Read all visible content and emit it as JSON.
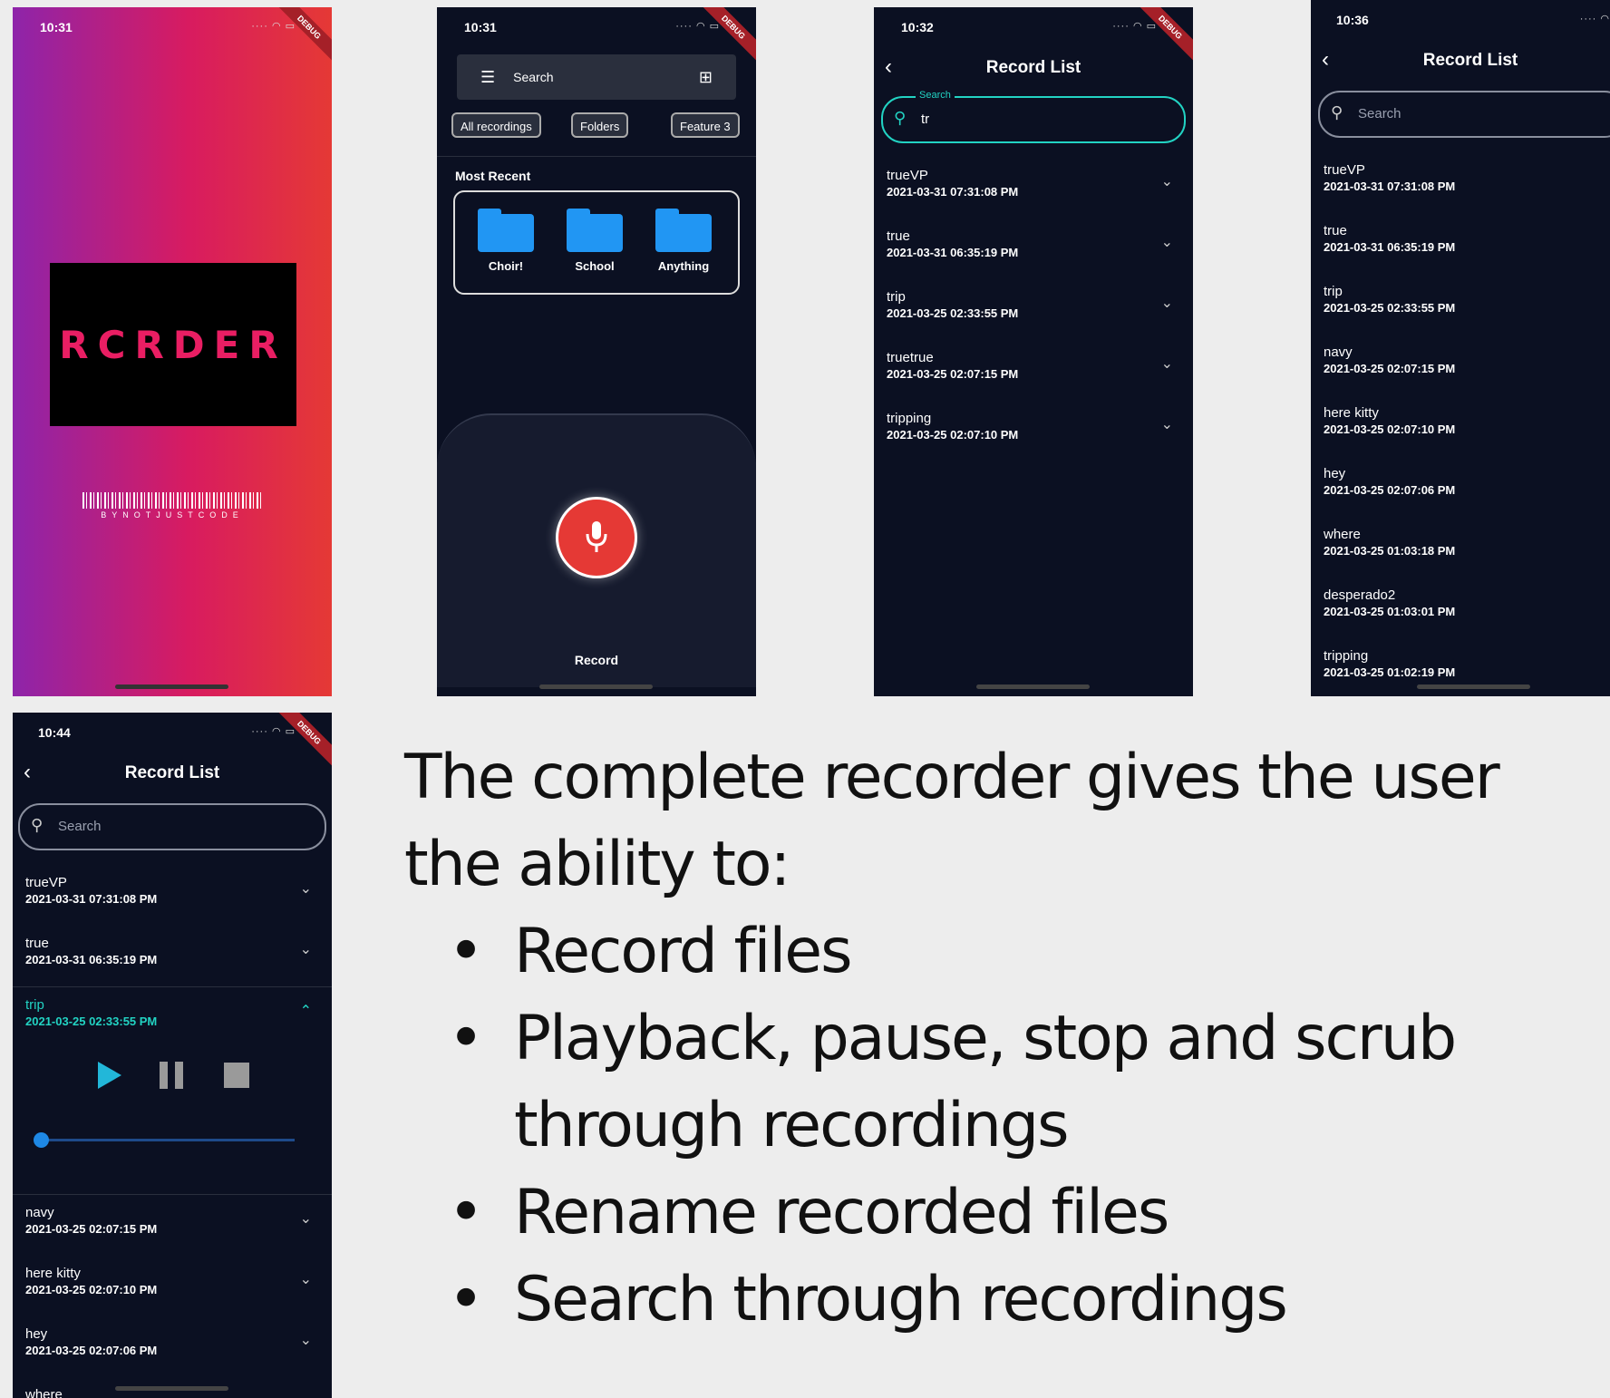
{
  "splash": {
    "time": "10:31",
    "logo": "RCRDER",
    "barcode_text": "BYNOTJUSTCODE",
    "debug": "DEBUG"
  },
  "home": {
    "time": "10:31",
    "search_label": "Search",
    "chips": [
      "All recordings",
      "Folders",
      "Feature 3"
    ],
    "most_recent_label": "Most Recent",
    "folders": [
      "Choir!",
      "School",
      "Anything"
    ],
    "record_label": "Record",
    "debug": "DEBUG"
  },
  "search_screen": {
    "time": "10:32",
    "title": "Record List",
    "search_float_label": "Search",
    "search_value": "tr",
    "items": [
      {
        "name": "trueVP",
        "date": "2021-03-31 07:31:08 PM"
      },
      {
        "name": "true",
        "date": "2021-03-31 06:35:19 PM"
      },
      {
        "name": "trip",
        "date": "2021-03-25 02:33:55 PM"
      },
      {
        "name": "truetrue",
        "date": "2021-03-25 02:07:15 PM"
      },
      {
        "name": "tripping",
        "date": "2021-03-25 02:07:10 PM"
      }
    ],
    "debug": "DEBUG"
  },
  "list_screen": {
    "time": "10:36",
    "title": "Record List",
    "search_placeholder": "Search",
    "items": [
      {
        "name": "trueVP",
        "date": "2021-03-31 07:31:08 PM"
      },
      {
        "name": "true",
        "date": "2021-03-31 06:35:19 PM"
      },
      {
        "name": "trip",
        "date": "2021-03-25 02:33:55 PM"
      },
      {
        "name": "navy",
        "date": "2021-03-25 02:07:15 PM"
      },
      {
        "name": "here kitty",
        "date": "2021-03-25 02:07:10 PM"
      },
      {
        "name": "hey",
        "date": "2021-03-25 02:07:06 PM"
      },
      {
        "name": "where",
        "date": "2021-03-25 01:03:18 PM"
      },
      {
        "name": "desperado2",
        "date": "2021-03-25 01:03:01 PM"
      },
      {
        "name": "tripping",
        "date": "2021-03-25 01:02:19 PM"
      }
    ]
  },
  "player_screen": {
    "time": "10:44",
    "title": "Record List",
    "search_placeholder": "Search",
    "items_before": [
      {
        "name": "trueVP",
        "date": "2021-03-31 07:31:08 PM"
      },
      {
        "name": "true",
        "date": "2021-03-31 06:35:19 PM"
      }
    ],
    "expanded": {
      "name": "trip",
      "date": "2021-03-25 02:33:55 PM"
    },
    "items_after": [
      {
        "name": "navy",
        "date": "2021-03-25 02:07:15 PM"
      },
      {
        "name": "here kitty",
        "date": "2021-03-25 02:07:10 PM"
      },
      {
        "name": "hey",
        "date": "2021-03-25 02:07:06 PM"
      },
      {
        "name": "where",
        "date": ""
      }
    ],
    "playback_progress": 0,
    "debug": "DEBUG"
  },
  "description": {
    "intro": "The complete recorder gives the user the ability to:",
    "bullets": [
      "Record files",
      "Playback, pause, stop and scrub through recordings",
      "Rename recorded files",
      "Search through recordings"
    ]
  },
  "colors": {
    "accent": "#22d3c3",
    "record_red": "#e53935",
    "folder_blue": "#2196f3",
    "screen_bg": "#0b1022"
  }
}
